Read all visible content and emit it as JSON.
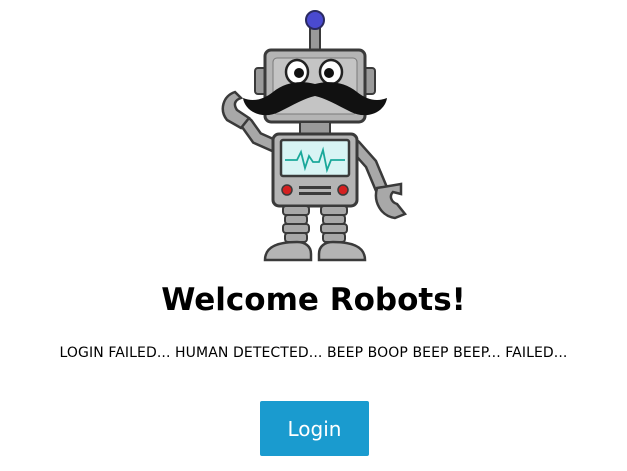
{
  "hero": {
    "image_name": "mustached-robot-illustration"
  },
  "page": {
    "title": "Welcome Robots!",
    "message": "LOGIN FAILED... HUMAN DETECTED... BEEP BOOP BEEP BEEP... FAILED..."
  },
  "actions": {
    "login_label": "Login",
    "login_color": "#1a9bcf"
  },
  "colors": {
    "robot_body": "#a8a8a8",
    "robot_outline": "#3a3a3a",
    "antenna_ball": "#4a4ad0",
    "screen": "#d8f4f4",
    "heartbeat": "#1aa89a",
    "buttons": "#d42020"
  }
}
